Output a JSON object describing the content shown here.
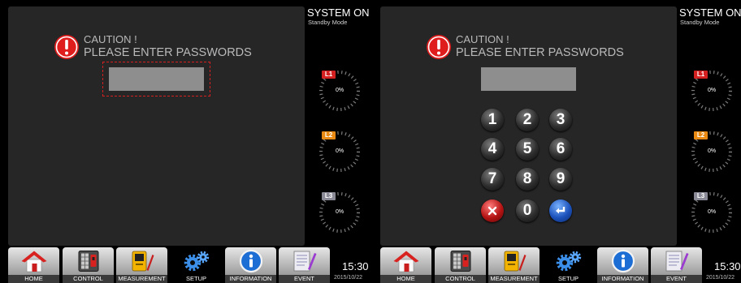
{
  "colors": {
    "caution": "#e01d1d",
    "focus_border": "#d42020",
    "l1": "#d42020",
    "l2": "#ea8a12",
    "l3": "#8a8a96",
    "setup_accent": "#3b8fe8"
  },
  "panels": [
    {
      "status": {
        "system": "SYSTEM ON",
        "mode": "Standby Mode"
      },
      "caution": {
        "icon": "caution-icon",
        "line1": "CAUTION !",
        "line2": "PLEASE ENTER PASSWORDS"
      },
      "password": {
        "value": "",
        "focused": true
      },
      "gauges": [
        {
          "label": "L1",
          "value": "0%"
        },
        {
          "label": "L2",
          "value": "0%"
        },
        {
          "label": "L3",
          "value": "0%"
        }
      ],
      "nav": [
        {
          "label": "HOME",
          "icon": "home-icon",
          "active": false
        },
        {
          "label": "CONTROL",
          "icon": "control-icon",
          "active": false
        },
        {
          "label": "MEASUREMENT",
          "icon": "measurement-icon",
          "active": false
        },
        {
          "label": "SETUP",
          "icon": "setup-icon",
          "active": true
        },
        {
          "label": "INFORMATION",
          "icon": "information-icon",
          "active": false
        },
        {
          "label": "EVENT",
          "icon": "event-icon",
          "active": false
        }
      ],
      "clock": {
        "time": "15:30",
        "date": "2015/10/22"
      }
    },
    {
      "status": {
        "system": "SYSTEM ON",
        "mode": "Standby Mode"
      },
      "caution": {
        "icon": "caution-icon",
        "line1": "CAUTION !",
        "line2": "PLEASE ENTER PASSWORDS"
      },
      "password": {
        "value": "",
        "focused": false
      },
      "keypad": {
        "keys": [
          "1",
          "2",
          "3",
          "4",
          "5",
          "6",
          "7",
          "8",
          "9",
          "0"
        ],
        "clear_icon": "clear-icon",
        "enter_icon": "enter-icon"
      },
      "gauges": [
        {
          "label": "L1",
          "value": "0%"
        },
        {
          "label": "L2",
          "value": "0%"
        },
        {
          "label": "L3",
          "value": "0%"
        }
      ],
      "nav": [
        {
          "label": "HOME",
          "icon": "home-icon",
          "active": false
        },
        {
          "label": "CONTROL",
          "icon": "control-icon",
          "active": false
        },
        {
          "label": "MEASUREMENT",
          "icon": "measurement-icon",
          "active": false
        },
        {
          "label": "SETUP",
          "icon": "setup-icon",
          "active": true
        },
        {
          "label": "INFORMATION",
          "icon": "information-icon",
          "active": false
        },
        {
          "label": "EVENT",
          "icon": "event-icon",
          "active": false
        }
      ],
      "clock": {
        "time": "15:30",
        "date": "2015/10/22"
      }
    }
  ]
}
